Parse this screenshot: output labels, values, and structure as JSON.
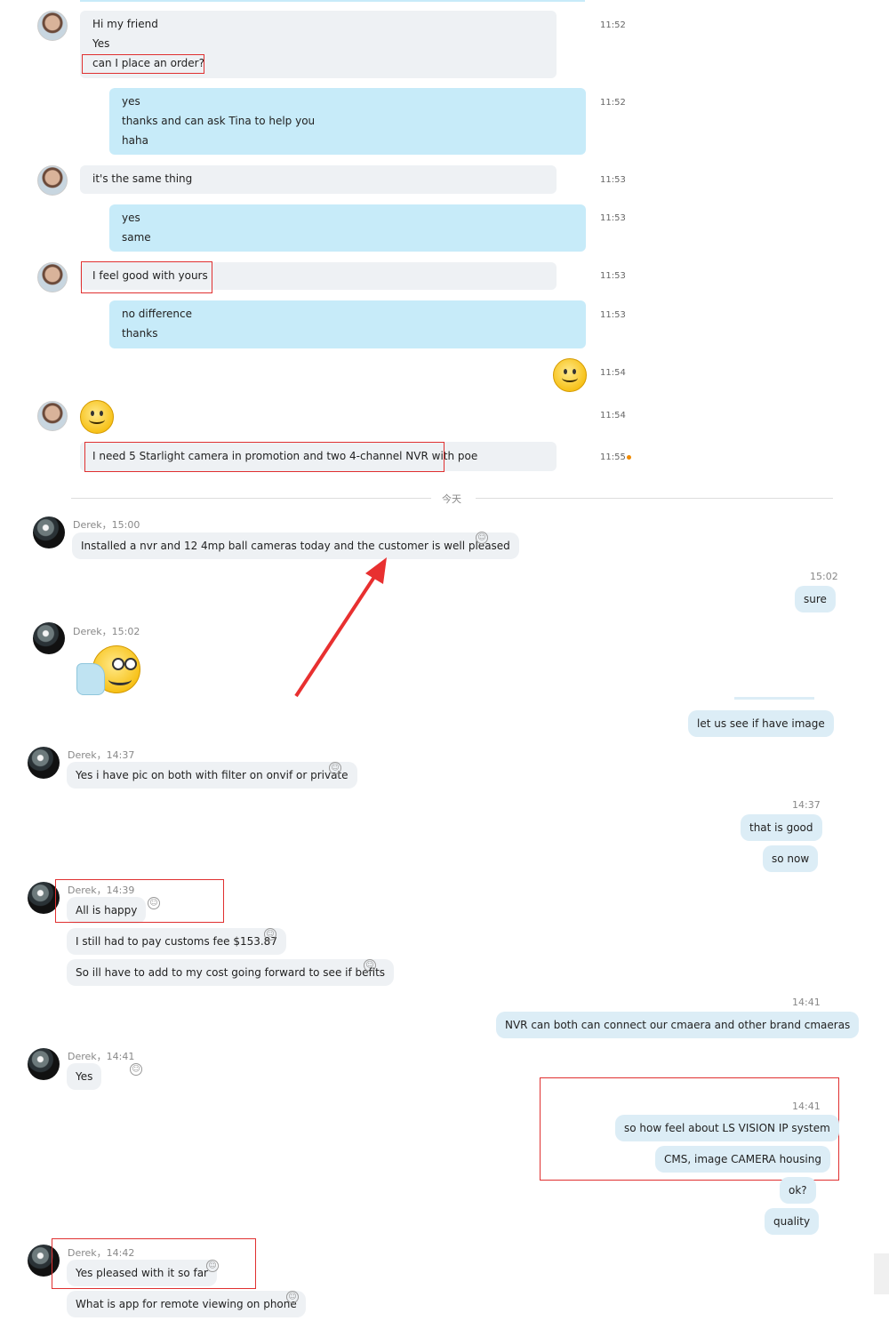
{
  "skype": {
    "m1": {
      "lines": [
        "Hi my friend",
        "Yes",
        "can I place an order?"
      ],
      "time": "11:52"
    },
    "m2": {
      "lines": [
        "yes",
        "thanks and can ask Tina to help you",
        "haha"
      ],
      "time": "11:52"
    },
    "m3": {
      "lines": [
        "it's the same thing"
      ],
      "time": "11:53"
    },
    "m4": {
      "lines": [
        "yes",
        "same"
      ],
      "time": "11:53"
    },
    "m5": {
      "lines": [
        "I feel good with yours"
      ],
      "time": "11:53"
    },
    "m6": {
      "lines": [
        "no difference",
        "thanks"
      ],
      "time": "11:53"
    },
    "m7": {
      "time": "11:54"
    },
    "m8": {
      "time": "11:54"
    },
    "m9": {
      "lines": [
        "I need 5 Starlight camera in promotion and two 4-channel NVR with poe"
      ],
      "time": "11:55"
    },
    "divider": "今天"
  },
  "chat": {
    "g1": {
      "name": "Derek",
      "time": "15:00",
      "text": "Installed a nvr and 12 4mp ball cameras today and the customer is well pleased"
    },
    "o1": {
      "time": "15:02",
      "text": "sure"
    },
    "g2": {
      "name": "Derek",
      "time": "15:02"
    },
    "o2": {
      "text": "let us see if have image"
    },
    "g3": {
      "name": "Derek",
      "time": "14:37",
      "text": "Yes i have pic on both with filter on onvif or private"
    },
    "o3": {
      "time": "14:37",
      "lines": [
        "that is good",
        "so now"
      ]
    },
    "g4": {
      "name": "Derek",
      "time": "14:39",
      "lines": [
        "All is happy",
        "I still had to pay customs fee $153.87",
        "So ill have to add to my cost going forward to see if befits"
      ]
    },
    "o4": {
      "time": "14:41",
      "text": "NVR can both can connect our cmaera and other brand cmaeras"
    },
    "g5": {
      "name": "Derek",
      "time": "14:41",
      "text": "Yes"
    },
    "o5": {
      "time": "14:41",
      "lines": [
        "so how feel about LS VISION IP system",
        "CMS, image CAMERA housing",
        "ok?",
        "quality"
      ]
    },
    "g6": {
      "name": "Derek",
      "time": "14:42",
      "lines": [
        "Yes pleased with it so far",
        "What is app for remote viewing on phone"
      ]
    }
  }
}
